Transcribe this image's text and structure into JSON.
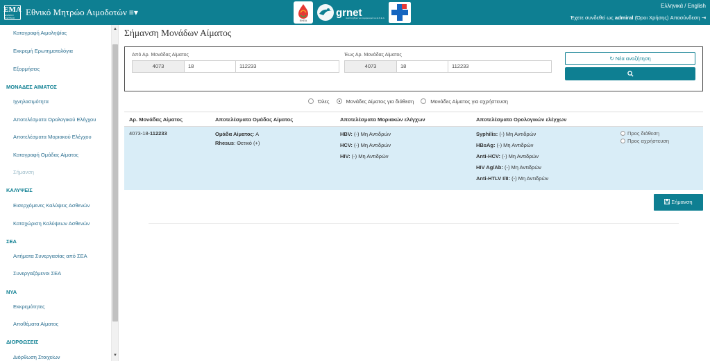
{
  "header": {
    "brand_logo_text": "ΕΜΑ",
    "brand_logo_sub": "ΕΘΝΙΚΟ ΜΗΤΡΩΟ",
    "title": "Εθνικό Μητρώο Αιμοδοτών",
    "menu_icon": "≡▾",
    "logo_grnet": "grnet",
    "logo_grnet_sub": "Αναπτύχθηκε για λογαριασμό του Ε.Κ.Ε.Α.",
    "logo_eoda_text": "ΕΚΕΑ",
    "lang_el": "Ελληνικά",
    "lang_sep": " / ",
    "lang_en": "English",
    "user_prefix": "Έχετε συνδεθεί ως ",
    "username": "admiral",
    "terms": "(Όροι Χρήσης)",
    "logout": "Αποσύνδεση",
    "logout_icon": "⇥"
  },
  "sidebar": {
    "items": [
      {
        "label": "Καταγραφή Αιμοληψίας"
      },
      {
        "label": "Εκκρεμή Ερωτηματολόγια"
      },
      {
        "label": "Εξορμήσεις"
      },
      {
        "section": "ΜΟΝΑΔΕΣ ΑΙΜΑΤΟΣ"
      },
      {
        "label": "Ιχνηλασιμότητα"
      },
      {
        "label": "Αποτελέσματα Ορολογικού Ελέγχου"
      },
      {
        "label": "Αποτελέσματα Μοριακού Ελέγχου"
      },
      {
        "label": "Καταγραφή Ομάδας Αίματος"
      },
      {
        "label": "Σήμανση"
      },
      {
        "section": "ΚΑΛΥΨΕΙΣ"
      },
      {
        "label": "Εισερχόμενες Καλύψεις Ασθενών"
      },
      {
        "label": "Καταχώριση Καλύψεων Ασθενών"
      },
      {
        "section": "ΣΕΑ"
      },
      {
        "label": "Αιτήματα Συνεργασίας από ΣΕΑ"
      },
      {
        "label": "Συνεργαζόμενοι ΣΕΑ"
      },
      {
        "section": "ΝΥΑ"
      },
      {
        "label": "Εκκρεμότητες"
      },
      {
        "label": "Αποθέματα Αίματος"
      },
      {
        "section": "ΔΙΟΡΘΩΣΕΙΣ"
      },
      {
        "label": "Διόρθωση Στοιχείων"
      }
    ]
  },
  "page": {
    "title": "Σήμανση Μονάδων Αίματος"
  },
  "search": {
    "from_label": "Από Αρ. Μονάδας Αίματος",
    "from_1": "4073",
    "from_2": "18",
    "from_3": "112233",
    "to_label": "Έως Αρ. Μονάδας Αίματος",
    "to_1": "4073",
    "to_2": "18",
    "to_3": "112233",
    "new_search_icon": "↻",
    "new_search": "Νέα αναζήτηση",
    "search_icon": "🔍"
  },
  "filters": {
    "all": "Όλες",
    "available": "Μονάδες Αίματος για διάθεση",
    "unusable": "Μονάδες Αίματος για αχρήστευση",
    "selected": "available"
  },
  "table": {
    "headers": [
      "Αρ. Μονάδας Αίματος",
      "Αποτελέσματα Ομάδας Αίματος",
      "Αποτελέσματα Μοριακών ελέγχων",
      "Αποτελέσματα Ορολογικών ελέγχων"
    ],
    "row": {
      "unit_prefix": "4073-18-",
      "unit_bold": "112233",
      "group_label": "Ομάδα Αίματος",
      "group_value": ": Α",
      "rhesus_label": "Rhesus",
      "rhesus_value": ": Θετικό (+)",
      "molecular": [
        {
          "name": "HBV:",
          "value": " (-) Μη Αντιδρών"
        },
        {
          "name": "HCV:",
          "value": " (-) Μη Αντιδρών"
        },
        {
          "name": "HIV:",
          "value": " (-) Μη Αντιδρών"
        }
      ],
      "serology": [
        {
          "name": "Syphilis:",
          "value": " (-) Μη Αντιδρών"
        },
        {
          "name": "HBsAg:",
          "value": " (-) Μη Αντιδρών"
        },
        {
          "name": "Anti-HCV:",
          "value": " (-) Μη Αντιδρών"
        },
        {
          "name": "HIV Ag/Ab:",
          "value": " (-) Μη Αντιδρών"
        },
        {
          "name": "Anti-HTLV I/II:",
          "value": " (-) Μη Αντιδρών"
        }
      ],
      "opt_available": "Προς διάθεση",
      "opt_unusable": "Προς αχρήστευση"
    }
  },
  "actions": {
    "mark_icon": "💾",
    "mark": "Σήμανση"
  },
  "colors": {
    "primary": "#0e7f92",
    "row_highlight": "#d9edf7",
    "sidebar_link": "#2a6e8f"
  }
}
